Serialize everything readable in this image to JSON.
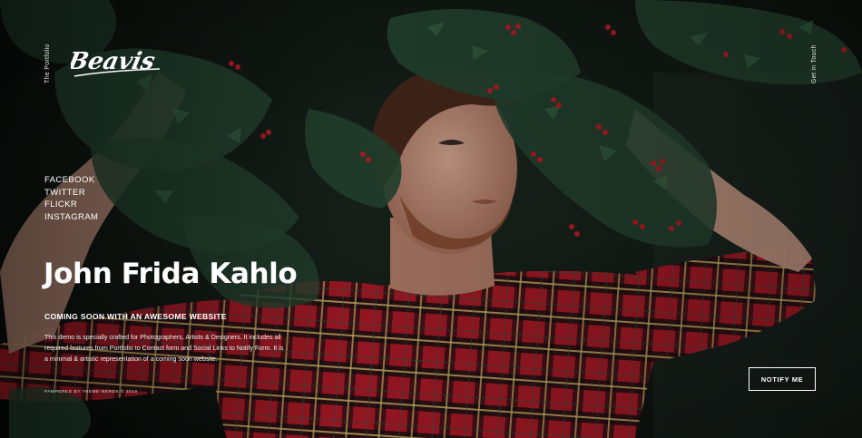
{
  "sidebar": {
    "tagline": "The Portfolio",
    "logo_text": "Beavis",
    "social_links": [
      "FACEBOOK",
      "TWITTER",
      "FLICKR",
      "INSTAGRAM"
    ]
  },
  "header": {
    "get_in_touch": "Get in Touch"
  },
  "hero": {
    "name": "John Frida Kahlo",
    "subheading": "COMING SOON WITH AN AWESOME WEBSITE",
    "description": "This demo is specially crafted for Photographers, Artists & Designers. It includes all required features from Portfolio to Contact form and Social Links to Notify Form. It is a minimal & artistic representation of a coming soon website.",
    "credit": "PAMPERED BY THEME-NERDS © 2016"
  },
  "cta": {
    "notify_label": "NOTIFY ME"
  },
  "background": {
    "subject": "man-in-red-plaid-shirt-with-holly-leaves-photo",
    "colors": {
      "shirt_red": "#c41f2c",
      "leaf_green": "#274a34",
      "berry_red": "#c2202a",
      "skin": "#d4a08a",
      "dark_bg": "#0d120f"
    }
  }
}
